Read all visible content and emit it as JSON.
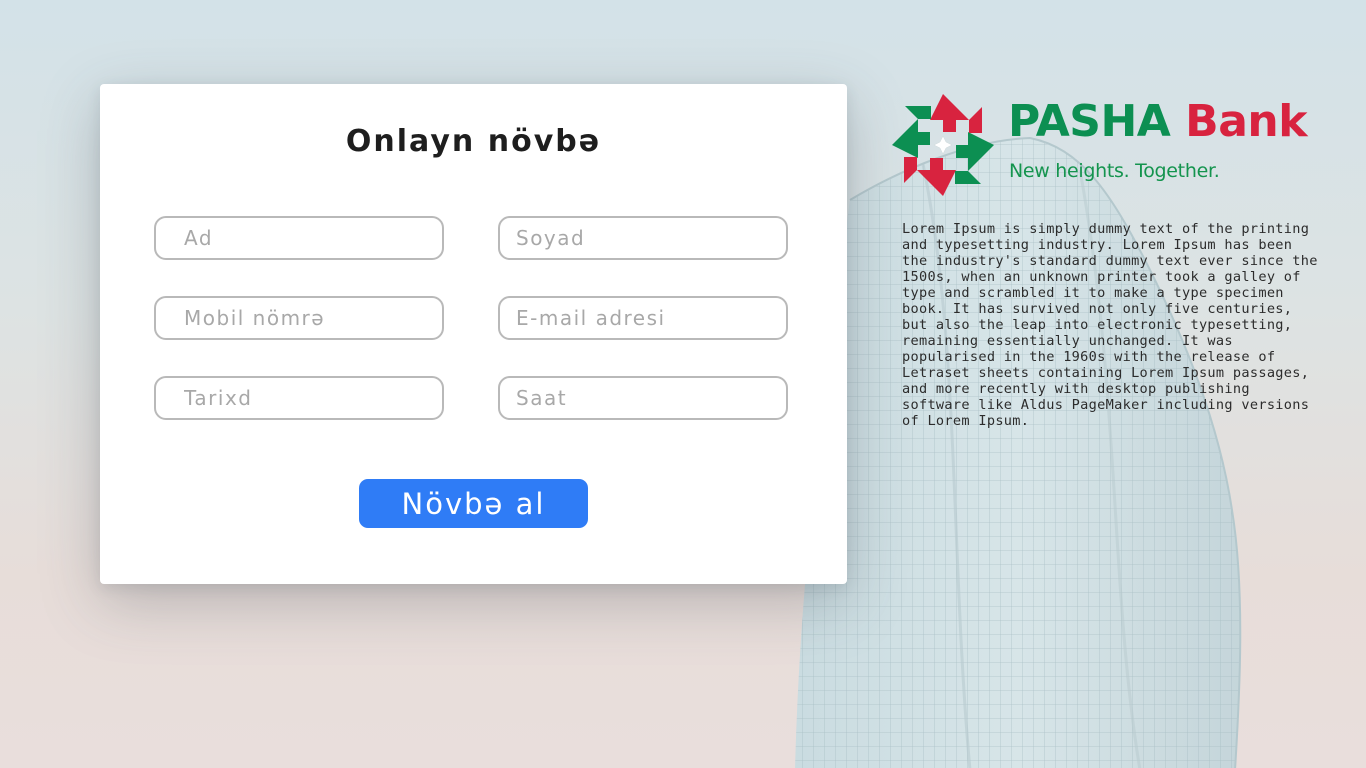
{
  "form": {
    "title": "Onlayn növbə",
    "fields": {
      "first_name": {
        "placeholder": "Ad"
      },
      "last_name": {
        "placeholder": "Soyad"
      },
      "phone": {
        "placeholder": "Mobil nömrə"
      },
      "email": {
        "placeholder": "E-mail adresi"
      },
      "date": {
        "placeholder": "Tarixd"
      },
      "time": {
        "placeholder": "Saat"
      }
    },
    "submit_label": "Növbə al"
  },
  "brand": {
    "name_part1": "PASHA",
    "name_part2": "Bank",
    "tagline": "New heights. Together.",
    "logo_icon": "pasha-bank-logo-icon",
    "colors": {
      "green": "#0c8f52",
      "red": "#d8233f",
      "button_blue": "#2f7cf6"
    }
  },
  "description": "Lorem Ipsum is simply dummy text of the printing and typesetting industry. Lorem Ipsum has been the industry's standard dummy text ever since the 1500s, when an unknown printer took a galley of type and scrambled it to make a type specimen book. It has survived not only five centuries, but also the leap into electronic typesetting, remaining essentially unchanged. It was popularised in the 1960s with the release of Letraset sheets containing Lorem Ipsum passages, and more recently with desktop publishing software like Aldus PageMaker including versions of Lorem Ipsum."
}
